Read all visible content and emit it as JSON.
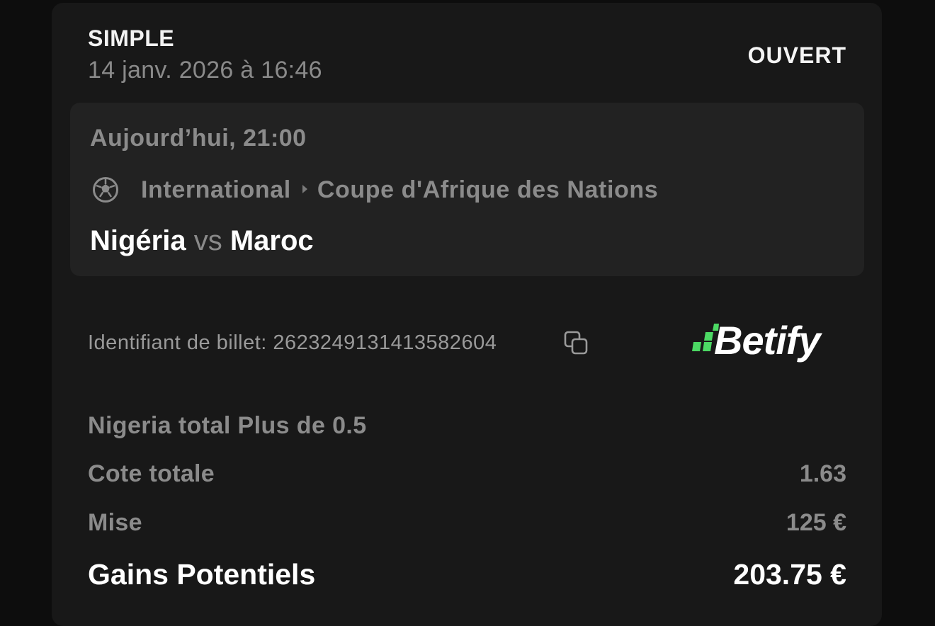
{
  "bet": {
    "type": "SIMPLE",
    "placed_at": "14 janv. 2026 à 16:46",
    "status": "OUVERT"
  },
  "event": {
    "time": "Aujourd’hui, 21:00",
    "sport_icon": "soccer-ball-icon",
    "category": "International",
    "competition": "Coupe d'Afrique des Nations",
    "home_team": "Nigéria",
    "vs": "vs",
    "away_team": "Maroc"
  },
  "ticket": {
    "label": "Identifiant de billet: 2623249131413582604",
    "copy_icon": "copy-icon"
  },
  "brand": {
    "name": "Betify",
    "accent_color": "#4cd964"
  },
  "selection": {
    "text": "Nigeria total Plus de 0.5"
  },
  "summary": {
    "odds_label": "Cote totale",
    "odds_value": "1.63",
    "stake_label": "Mise",
    "stake_value": "125 €",
    "potential_label": "Gains Potentiels",
    "potential_value": "203.75 €"
  }
}
